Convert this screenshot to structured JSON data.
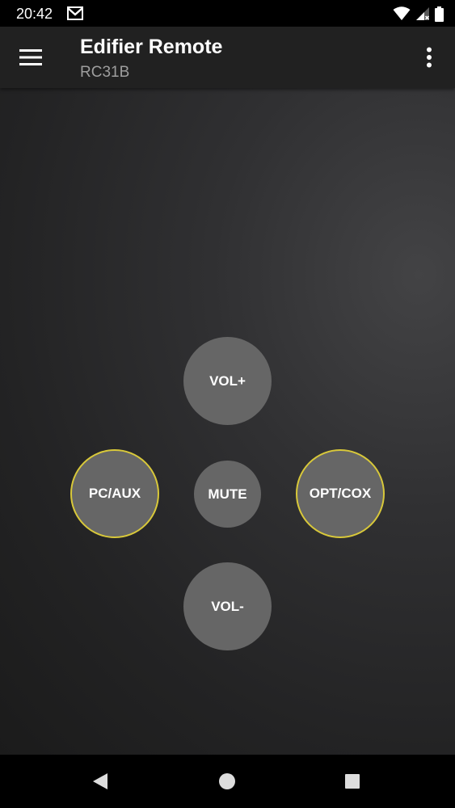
{
  "status_bar": {
    "time": "20:42",
    "icons": [
      "gmail-icon",
      "wifi-icon",
      "cell-signal-icon",
      "battery-icon"
    ]
  },
  "app_bar": {
    "title": "Edifier Remote",
    "subtitle": "RC31B",
    "menu_icon": "hamburger-menu-icon",
    "overflow_icon": "more-vert-icon"
  },
  "remote": {
    "vol_up": "VOL+",
    "pc_aux": "PC/AUX",
    "mute": "MUTE",
    "opt_cox": "OPT/COX",
    "vol_down": "VOL-"
  },
  "nav_bar": {
    "icons": [
      "back-icon",
      "home-icon",
      "recents-icon"
    ]
  },
  "colors": {
    "status_bar_bg": "#000000",
    "app_bar_bg": "#212121",
    "button_fill": "#666666",
    "selected_ring": "#d8c83a",
    "subtitle_text": "#9e9e9e",
    "nav_bar_bg": "#000000"
  }
}
